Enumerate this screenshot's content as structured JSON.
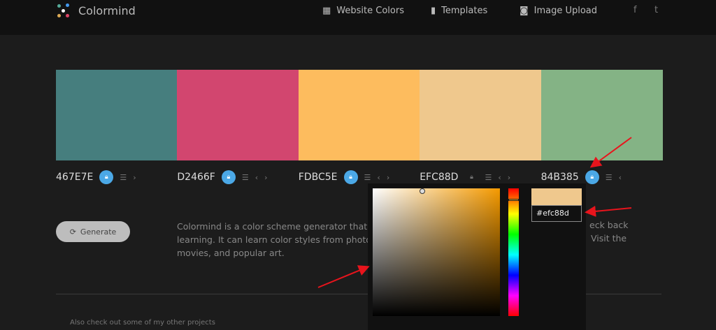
{
  "header": {
    "brand": "Colormind",
    "nav": [
      {
        "label": "Website Colors",
        "icon": "grid-icon"
      },
      {
        "label": "Templates",
        "icon": "bookmark-icon"
      },
      {
        "label": "Image Upload",
        "icon": "camera-icon"
      }
    ],
    "social": [
      "f",
      "t"
    ]
  },
  "palette": [
    {
      "hex": "467E7E",
      "color": "#467e7e",
      "locked": true
    },
    {
      "hex": "D2466F",
      "color": "#d2466f",
      "locked": true
    },
    {
      "hex": "FDBC5E",
      "color": "#fdbc5e",
      "locked": true
    },
    {
      "hex": "EFC88D",
      "color": "#efc88d",
      "locked": false
    },
    {
      "hex": "84B385",
      "color": "#84b385",
      "locked": true
    }
  ],
  "generate_label": "Generate",
  "description": {
    "lines": [
      "Colormind is a color scheme generator that uses",
      "learning. It can learn color styles from photograp",
      "movies, and popular art."
    ],
    "right_fragments": [
      "eck back",
      "Visit the"
    ]
  },
  "more_projects": "Also check out some of my other projects",
  "picker": {
    "hex_value": "#efc88d",
    "preview_color": "#efc88d"
  },
  "annotation_color": "#e8141c"
}
